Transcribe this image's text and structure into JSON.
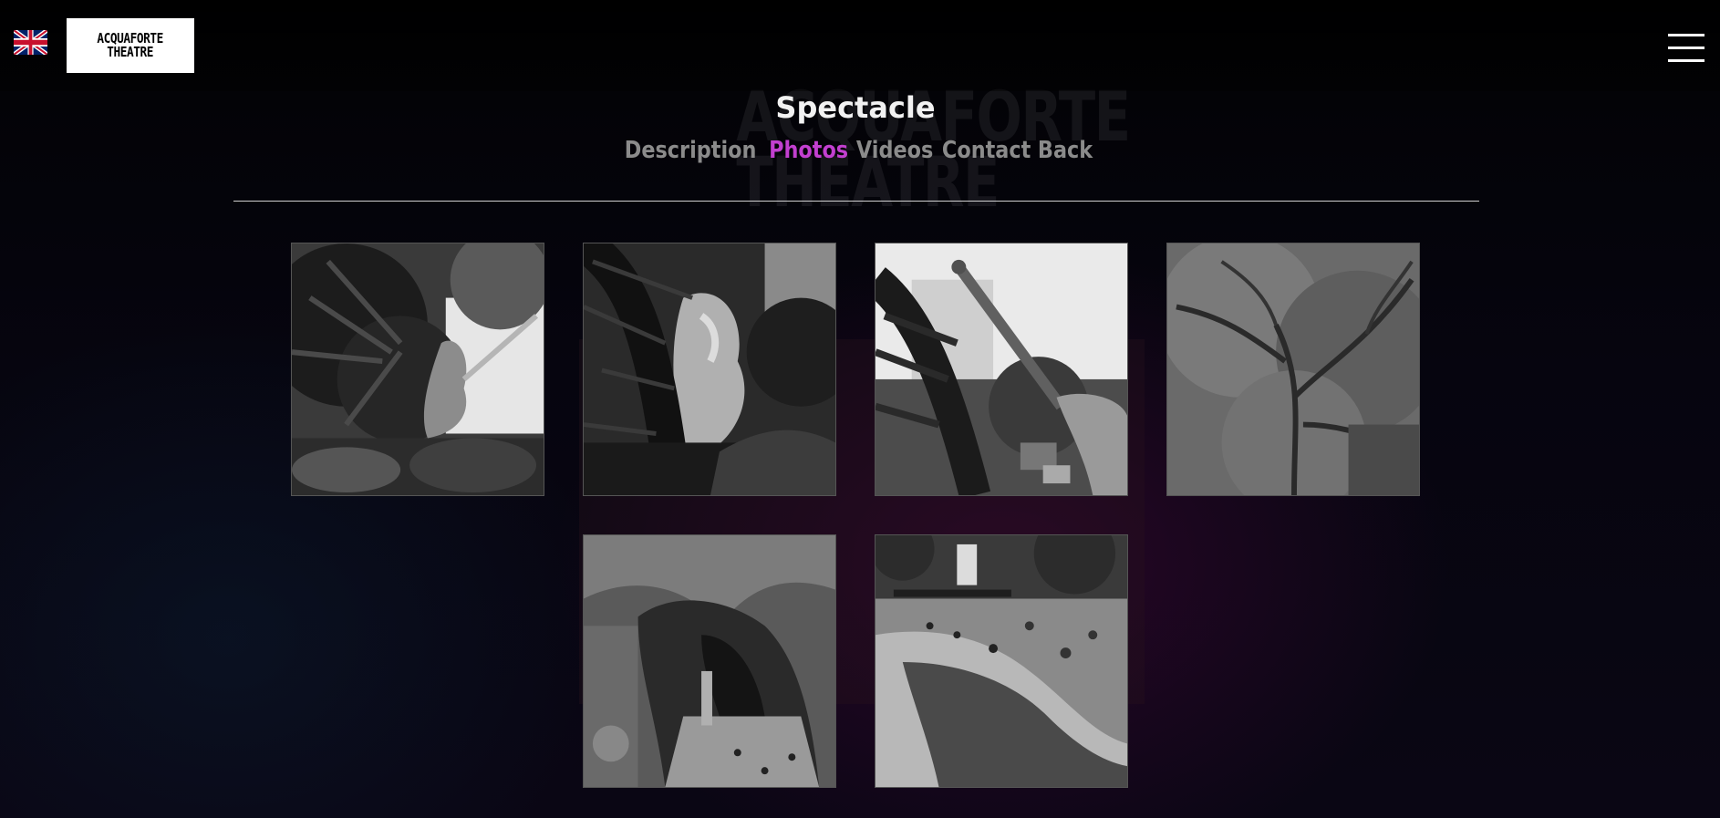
{
  "header": {
    "language_flag": "uk-flag-icon",
    "logo_text": "ACQUAFORTE\nTHEATRE",
    "menu_icon": "hamburger-menu-icon"
  },
  "background": {
    "logo_text": "ACQUAFORTE THEATRE"
  },
  "page": {
    "title": "Spectacle",
    "tabs": [
      {
        "label": "Description",
        "active": false
      },
      {
        "label": "Photos",
        "active": true
      },
      {
        "label": "Videos",
        "active": false
      },
      {
        "label": "Contact",
        "active": false
      },
      {
        "label": "Back",
        "active": false
      }
    ]
  },
  "gallery": {
    "photos": [
      {
        "subject": "statue-among-palms"
      },
      {
        "subject": "statue-under-palm-fronds"
      },
      {
        "subject": "statue-arm-raised-street"
      },
      {
        "subject": "tree-canopy"
      },
      {
        "subject": "grotto-cave"
      },
      {
        "subject": "park-fountain-pigeons"
      }
    ]
  },
  "colors": {
    "accent": "#c23fcf",
    "tab_inactive": "#8b8b8b",
    "title": "#f2f2f2"
  }
}
